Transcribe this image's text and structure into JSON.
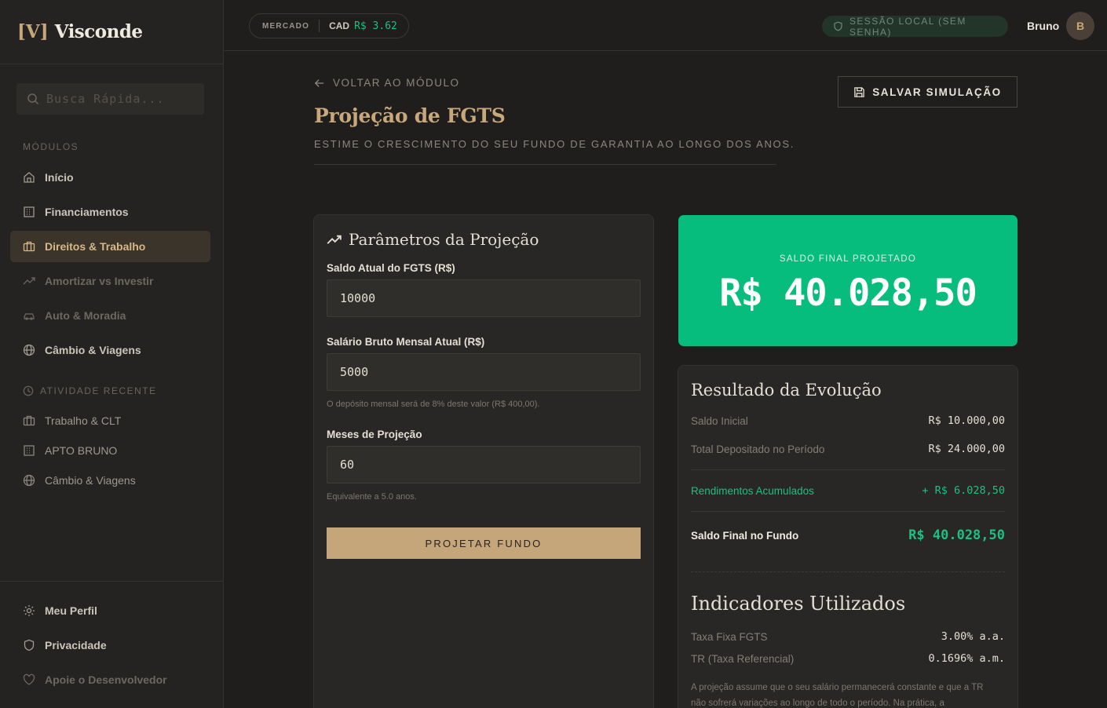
{
  "brand": {
    "mark": "[V]",
    "name": "Visconde"
  },
  "search": {
    "placeholder": "Busca Rápida..."
  },
  "sidebar": {
    "modules_label": "MÓDULOS",
    "items": [
      {
        "label": "Início",
        "icon": "home-icon"
      },
      {
        "label": "Financiamentos",
        "icon": "building-icon"
      },
      {
        "label": "Direitos & Trabalho",
        "icon": "briefcase-icon"
      },
      {
        "label": "Amortizar vs Investir",
        "icon": "trending-up-icon"
      },
      {
        "label": "Auto & Moradia",
        "icon": "car-icon"
      },
      {
        "label": "Câmbio & Viagens",
        "icon": "globe-icon"
      }
    ],
    "recent_label": "ATIVIDADE RECENTE",
    "recent": [
      {
        "label": "Trabalho & CLT",
        "icon": "briefcase-icon"
      },
      {
        "label": "APTO BRUNO",
        "icon": "building-icon"
      },
      {
        "label": "Câmbio & Viagens",
        "icon": "globe-icon"
      }
    ],
    "footer": [
      {
        "label": "Meu Perfil",
        "icon": "gear-icon"
      },
      {
        "label": "Privacidade",
        "icon": "shield-icon"
      },
      {
        "label": "Apoie o Desenvolvedor",
        "icon": "heart-icon"
      }
    ]
  },
  "topbar": {
    "market_label": "MERCADO",
    "currency": "CAD",
    "rate": "R$ 3.62",
    "session": "SESSÃO LOCAL (SEM SENHA)",
    "user": "Bruno",
    "avatar": "B"
  },
  "page": {
    "back": "VOLTAR AO MÓDULO",
    "title": "Projeção de FGTS",
    "subtitle": "ESTIME O CRESCIMENTO DO SEU FUNDO DE GARANTIA AO LONGO DOS ANOS.",
    "save": "SALVAR SIMULAÇÃO"
  },
  "params": {
    "title": "Parâmetros da Projeção",
    "saldo_label": "Saldo Atual do FGTS (R$)",
    "saldo_value": "10000",
    "salario_label": "Salário Bruto Mensal Atual (R$)",
    "salario_value": "5000",
    "salario_hint": "O depósito mensal será de 8% deste valor (R$ 400,00).",
    "meses_label": "Meses de Projeção",
    "meses_value": "60",
    "meses_hint": "Equivalente a 5.0 anos.",
    "button": "PROJETAR FUNDO"
  },
  "hero": {
    "label": "SALDO FINAL PROJETADO",
    "value": "R$ 40.028,50"
  },
  "result": {
    "title": "Resultado da Evolução",
    "saldo_inicial_label": "Saldo Inicial",
    "saldo_inicial": "R$ 10.000,00",
    "depositado_label": "Total Depositado no Período",
    "depositado": "R$ 24.000,00",
    "rendimentos_label": "Rendimentos Acumulados",
    "rendimentos": "+ R$ 6.028,50",
    "final_label": "Saldo Final no Fundo",
    "final": "R$ 40.028,50",
    "indicators_title": "Indicadores Utilizados",
    "taxa_label": "Taxa Fixa FGTS",
    "taxa": "3.00% a.a.",
    "tr_label": "TR (Taxa Referencial)",
    "tr": "0.1696% a.m.",
    "note": "A projeção assume que o seu salário permanecerá constante e que a TR não sofrerá variações ao longo de todo o período. Na prática, a"
  },
  "colors": {
    "accent": "#c8a77a",
    "success": "#06bd7d",
    "background": "#1f1e1c",
    "panel": "#282725"
  }
}
